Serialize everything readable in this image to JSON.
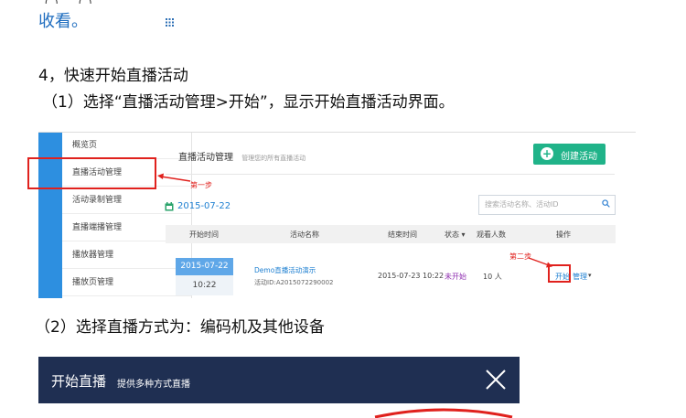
{
  "doc": {
    "cutoff_line": "（        ）          （        ）",
    "collect_text": "收看。",
    "step4_title": "4，快速开始直播活动",
    "step4_1": "（1）选择“直播活动管理>开始”，显示开始直播活动界面。",
    "step4_2": "（2）选择直播方式为：编码机及其他设备"
  },
  "screenshot1": {
    "sidebar": {
      "items": [
        {
          "label": "概览页"
        },
        {
          "label": "直播活动管理"
        },
        {
          "label": "活动录制管理"
        },
        {
          "label": "直播端播管理"
        },
        {
          "label": "播放器管理"
        },
        {
          "label": "播放页管理"
        }
      ],
      "active_index": 1
    },
    "header": {
      "title": "直播活动管理",
      "subtitle": "管理您的所有直播活动",
      "create_button": "创建活动"
    },
    "filter": {
      "date": "2015-07-22",
      "search_placeholder": "搜索活动名称、活动ID"
    },
    "table": {
      "columns": [
        "开始时间",
        "活动名称",
        "结束时间",
        "状态 ▾",
        "观看人数",
        "操作"
      ],
      "rows": [
        {
          "start_date": "2015-07-22",
          "start_time": "10:22",
          "name": "Demo直播活动演示",
          "id_line": "活动ID:A2015072290002",
          "end_time": "2015-07-23 10:22",
          "status": "未开始",
          "viewers": "10 人",
          "op_start": "开始",
          "op_manage": "管理",
          "op_caret": "▾"
        }
      ]
    },
    "annotations": {
      "step1": "第一步",
      "step2": "第二步",
      "color": "#e0211d"
    }
  },
  "screenshot2": {
    "title": "开始直播",
    "subtitle": "提供多种方式直播",
    "bar_color": "#1f2f52"
  }
}
